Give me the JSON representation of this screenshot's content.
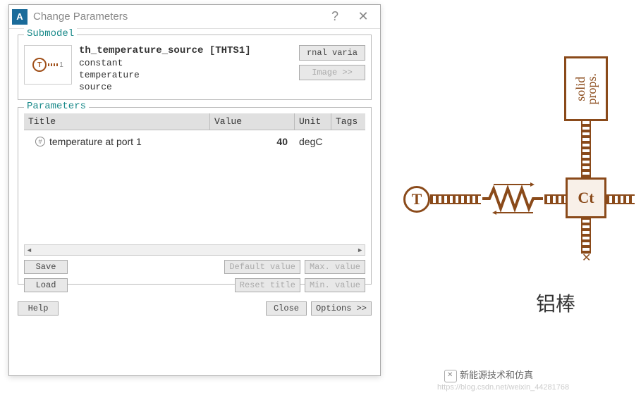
{
  "dialog": {
    "title": "Change Parameters",
    "help_btn": "?",
    "close_btn": "✕"
  },
  "submodel": {
    "group_title": "Submodel",
    "name": "th_temperature_source [THTS1]",
    "desc_l1": "constant",
    "desc_l2": "temperature",
    "desc_l3": "source",
    "port_num": "1",
    "rnal_varia_btn": "rnal varia",
    "image_btn": "Image >>"
  },
  "parameters": {
    "group_title": "Parameters",
    "headers": {
      "title": "Title",
      "value": "Value",
      "unit": "Unit",
      "tags": "Tags"
    },
    "rows": [
      {
        "title": "temperature at port 1",
        "value": "40",
        "unit": "degC",
        "tags": ""
      }
    ],
    "buttons": {
      "save": "Save",
      "load": "Load",
      "default_value": "Default value",
      "reset_title": "Reset title",
      "max_value": "Max. value",
      "min_value": "Min. value"
    }
  },
  "footer": {
    "help": "Help",
    "close": "Close",
    "options": "Options >>"
  },
  "diagram": {
    "solid_props_l1": "solid",
    "solid_props_l2": "props.",
    "t_label": "T",
    "ct_label": "Ct",
    "cn_label": "铝棒"
  },
  "watermark": {
    "text1": "新能源技术和仿真",
    "text2": "https://blog.csdn.net/weixin_44281768"
  }
}
